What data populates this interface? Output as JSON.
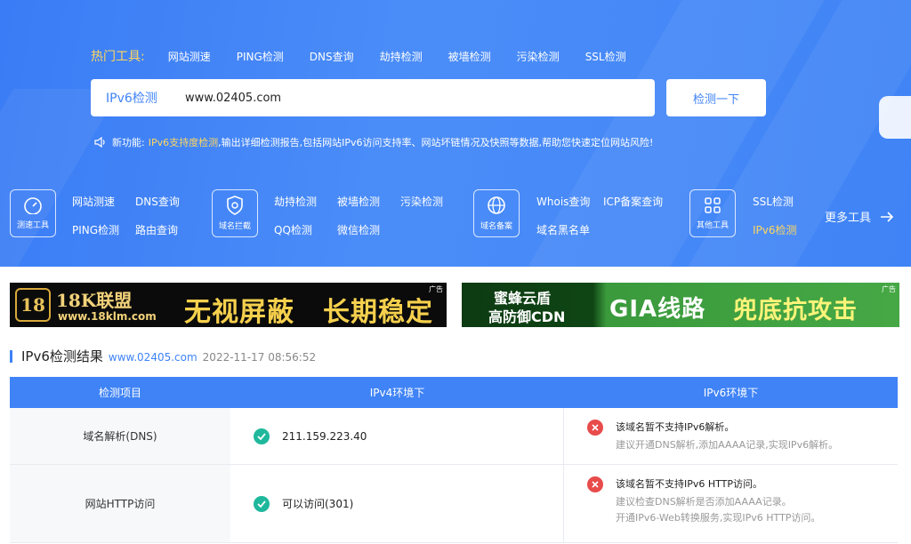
{
  "hot": {
    "title": "热门工具:",
    "links": [
      "网站测速",
      "PING检测",
      "DNS查询",
      "劫持检测",
      "被墙检测",
      "污染检测",
      "SSL检测"
    ]
  },
  "search": {
    "type_label": "IPv6检测",
    "value": "www.02405.com",
    "button": "检测一下"
  },
  "notice": {
    "prefix": "新功能:",
    "highlight": "IPv6支持度检测",
    "rest": ",输出详细检测报告,包括网站IPv6访问支持率、网站坏链情况及快照等数据,帮助您快速定位网站风险!"
  },
  "categories": [
    {
      "label": "测速工具",
      "icon": "speedometer-icon",
      "tools": [
        "网站测速",
        "DNS查询",
        "PING检测",
        "路由查询"
      ]
    },
    {
      "label": "域名拦截",
      "icon": "shield-icon",
      "tools": [
        "劫持检测",
        "被墙检测",
        "污染检测",
        "QQ检测",
        "微信检测"
      ]
    },
    {
      "label": "域名备案",
      "icon": "globe-icon",
      "tools": [
        "Whois查询",
        "ICP备案查询",
        "域名黑名单"
      ]
    },
    {
      "label": "其他工具",
      "icon": "grid-icon",
      "tools": [
        "SSL检测",
        "IPv6检测"
      ]
    }
  ],
  "more_tools": "更多工具",
  "ads": {
    "ad1": {
      "brand_num": "18K联盟",
      "site": "www.18klm.com",
      "slogan1": "无视屏蔽",
      "slogan2": "长期稳定",
      "tag": "广告"
    },
    "ad2": {
      "line1": "蜜蜂云盾",
      "line2": "高防御CDN",
      "slogan1": "GIA线路",
      "slogan2": "兜底抗攻击",
      "tag": "广告"
    }
  },
  "result": {
    "title": "IPv6检测结果",
    "domain": "www.02405.com",
    "time": "2022-11-17 08:56:52",
    "headers": [
      "检测项目",
      "IPv4环境下",
      "IPv6环境下"
    ],
    "rows": [
      {
        "item": "域名解析(DNS)",
        "ipv4": "211.159.223.40",
        "ipv6_title": "该域名暂不支持IPv6解析。",
        "ipv6_sub1": "建议开通DNS解析,添加AAAA记录,实现IPv6解析。",
        "ipv6_sub2": ""
      },
      {
        "item": "网站HTTP访问",
        "ipv4": "可以访问(301)",
        "ipv6_title": "该域名暂不支持IPv6 HTTP访问。",
        "ipv6_sub1": "建议检查DNS解析是否添加AAAA记录。",
        "ipv6_sub2": "开通IPv6-Web转换服务,实现IPv6 HTTP访问。"
      }
    ]
  },
  "colors": {
    "primary": "#3f83f6",
    "highlight": "#ffd75e",
    "ok": "#1fb89c",
    "error": "#e84b4b"
  }
}
